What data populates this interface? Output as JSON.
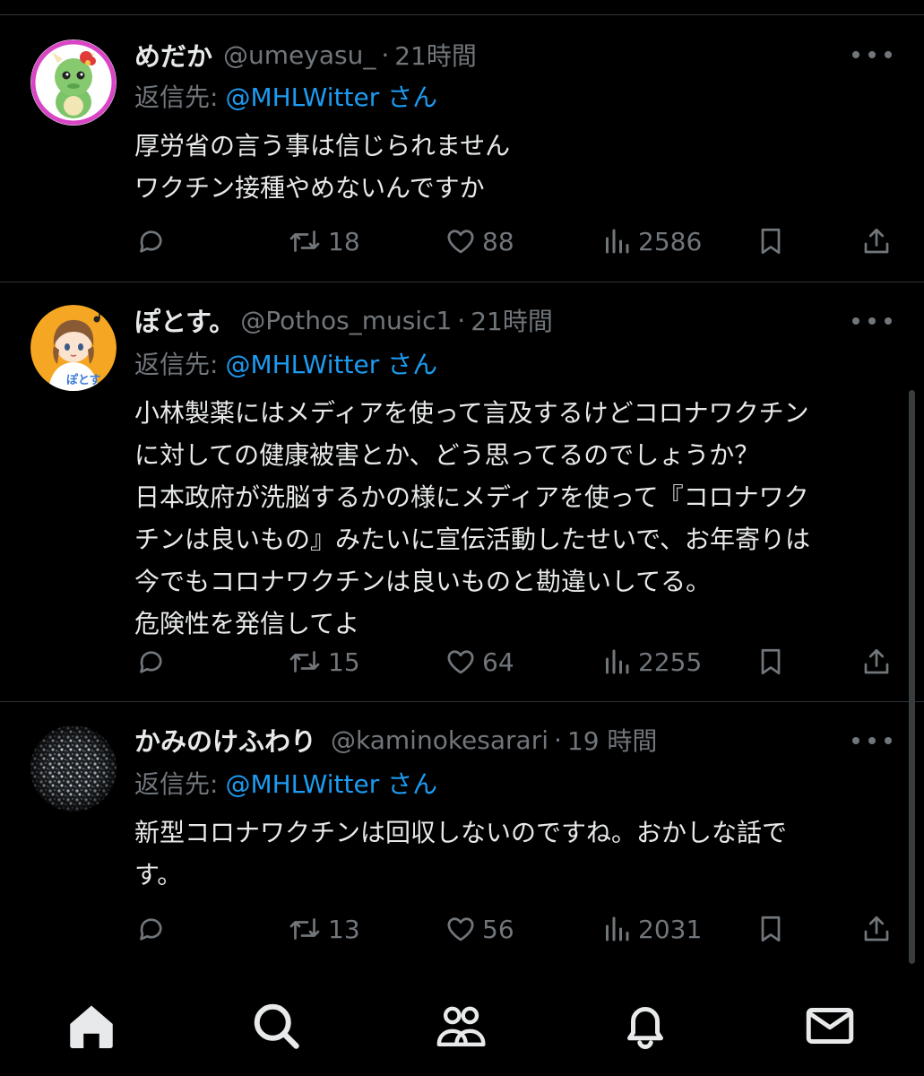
{
  "reply_prefix": "返信先:",
  "reply_suffix": "さん",
  "tweets": [
    {
      "name": "めだか",
      "handle": "@umeyasu_",
      "time": "21時間",
      "reply_to": "@MHLWitter",
      "lines": [
        "厚労省の言う事は信じられません",
        "ワクチン接種やめないんですか"
      ],
      "retweets": "18",
      "likes": "88",
      "views": "2586",
      "avatar_icon": "green-dragon-avatar"
    },
    {
      "name": "ぽとす。",
      "handle": "@Pothos_music1",
      "time": "21時間",
      "reply_to": "@MHLWitter",
      "lines": [
        "小林製薬にはメディアを使って言及するけどコロナワクチン",
        "に対しての健康被害とか、どう思ってるのでしょうか？",
        "日本政府が洗脳するかの様にメディアを使って『コロナワク",
        "チンは良いもの』みたいに宣伝活動したせいで、お年寄りは",
        "今でもコロナワクチンは良いものと勘違いしてる。",
        "危険性を発信してよ"
      ],
      "retweets": "15",
      "likes": "64",
      "views": "2255",
      "avatar_icon": "anime-girl-avatar",
      "avatar_text": "ぽとす"
    },
    {
      "name": "かみのけふわり",
      "handle": "@kaminokesarari",
      "time": "19 時間",
      "reply_to": "@MHLWitter",
      "lines": [
        "新型コロナワクチンは回収しないのですね。おかしな話で",
        "す。"
      ],
      "retweets": "13",
      "likes": "56",
      "views": "2031",
      "avatar_icon": "speckled-texture-avatar"
    }
  ],
  "tabbar": [
    "home-icon",
    "search-icon",
    "communities-icon",
    "notifications-icon",
    "messages-icon"
  ],
  "colors": {
    "background": "#000000",
    "text": "#e7e9ea",
    "muted": "#71767b",
    "accent": "#1d9bf0",
    "divider": "#2f3336"
  }
}
